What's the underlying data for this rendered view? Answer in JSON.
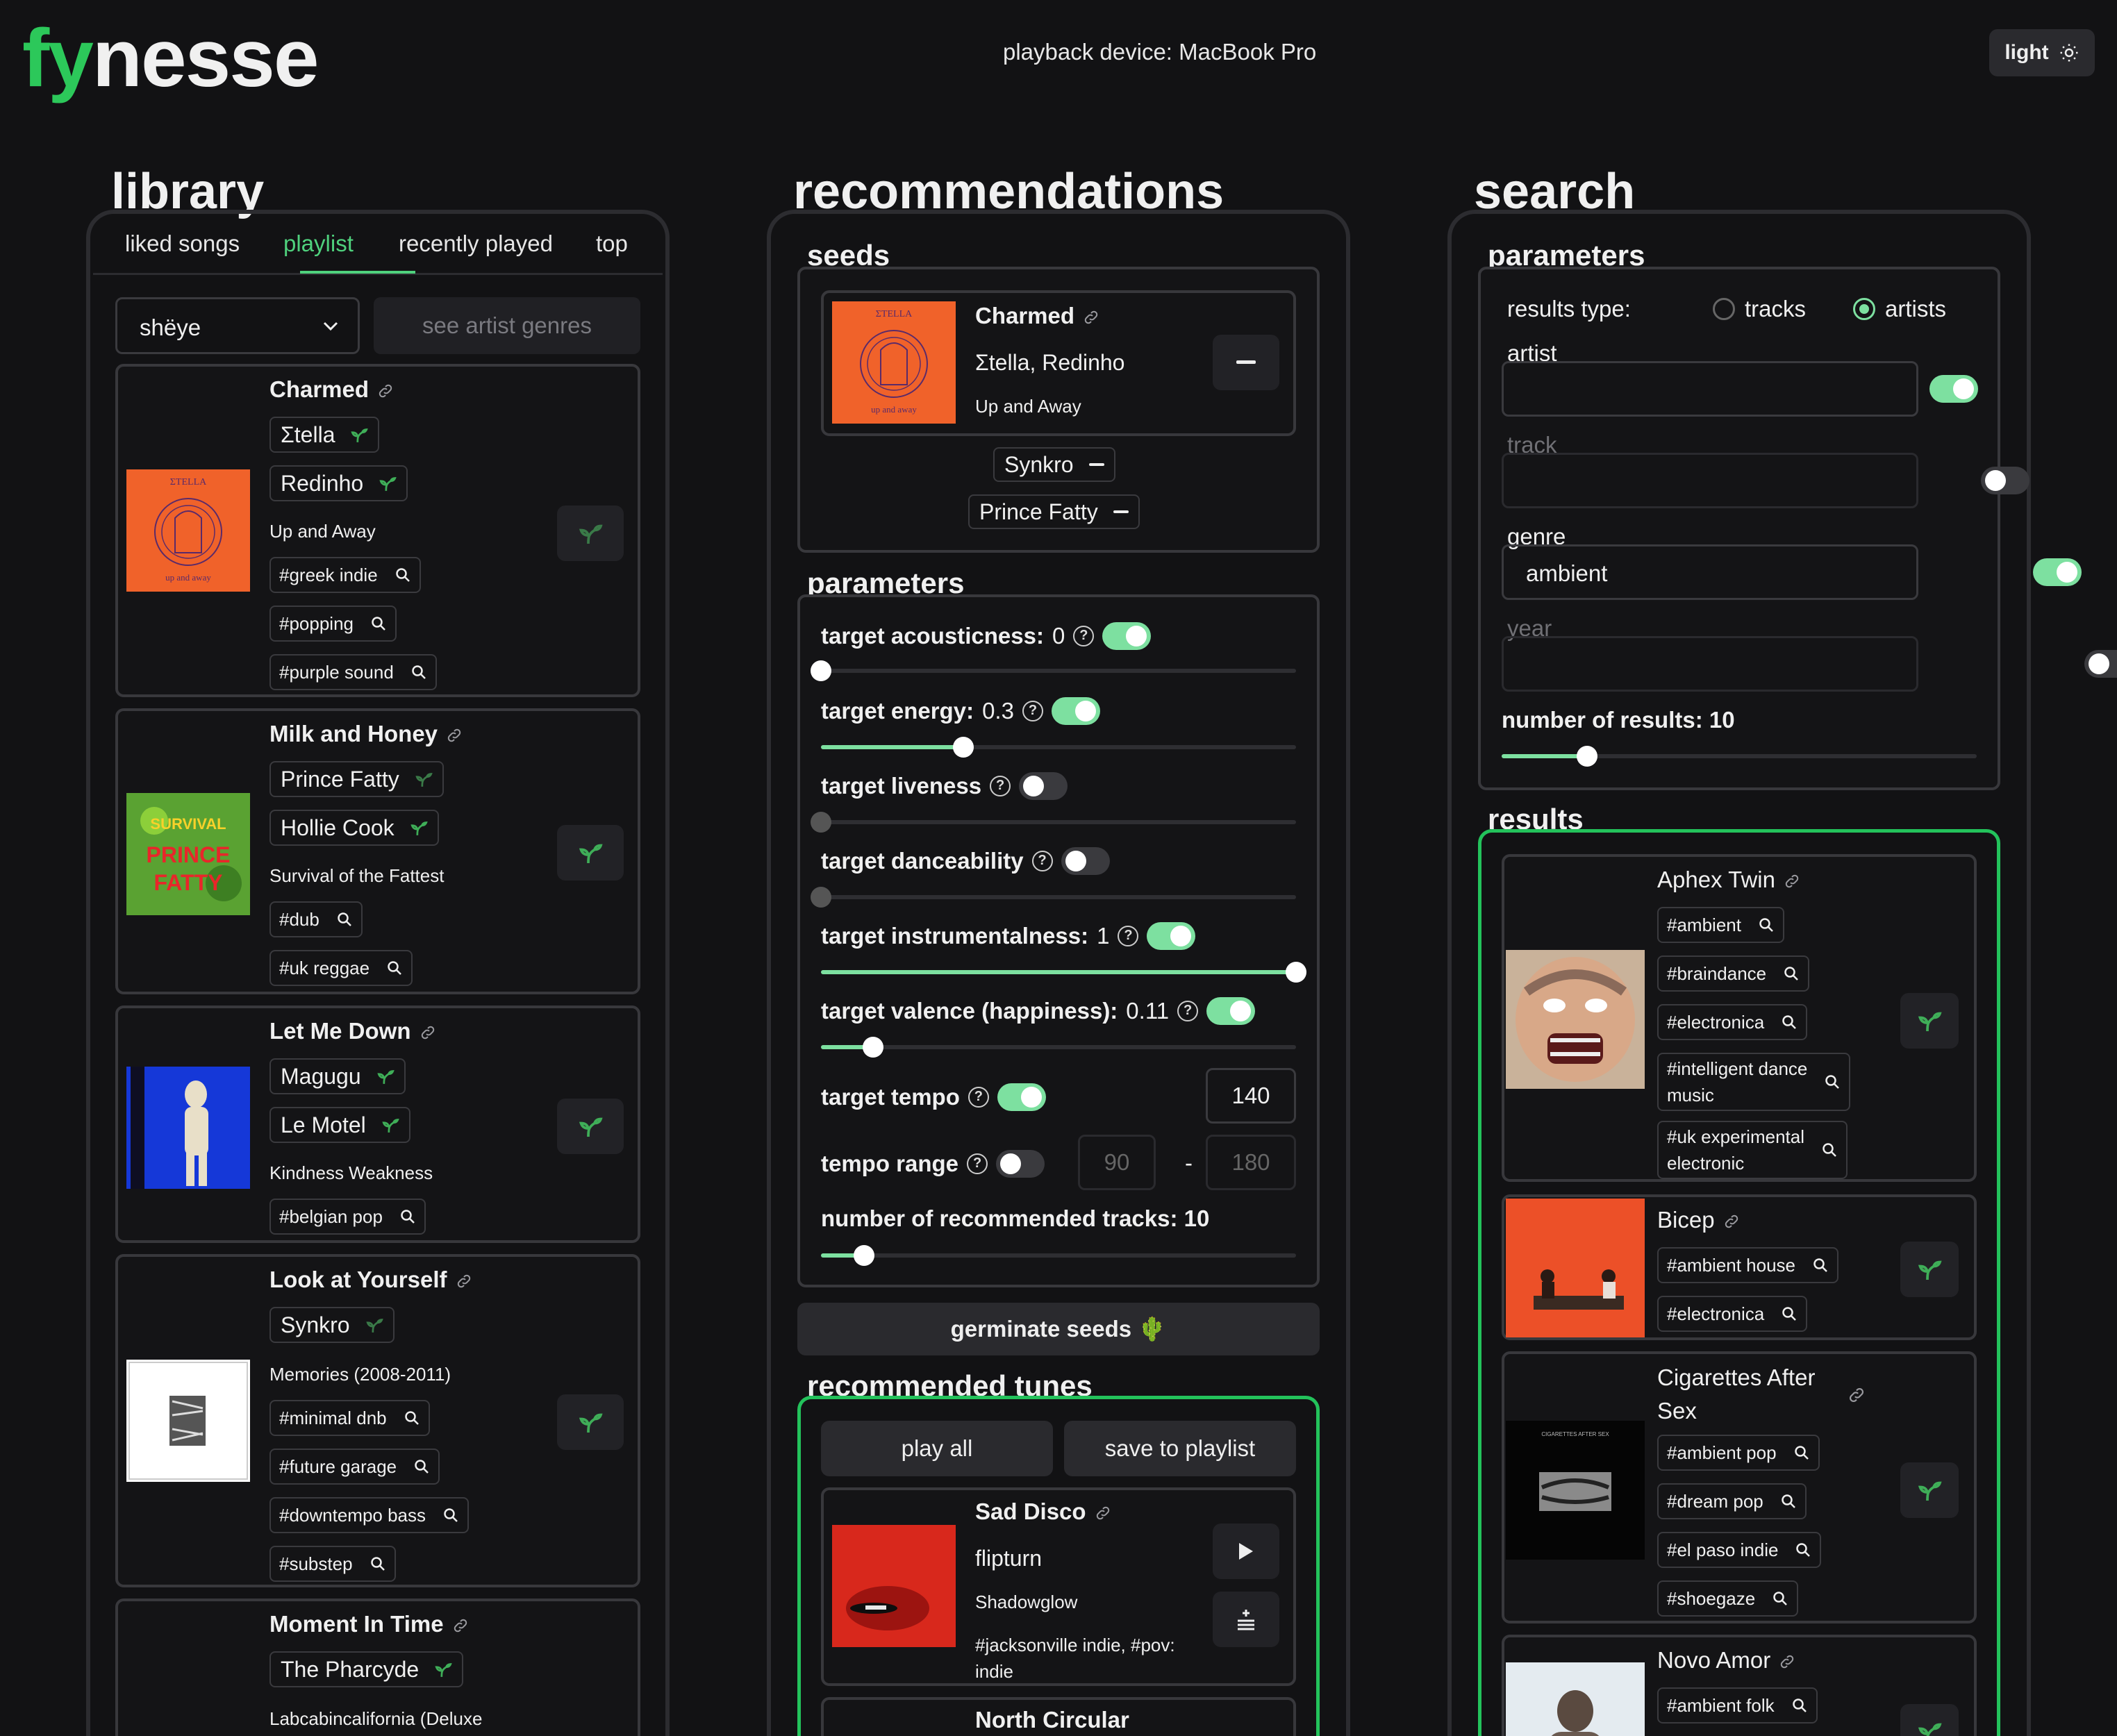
{
  "app": {
    "logo_part1": "fy",
    "logo_part2": "nesse",
    "device": "playback device: MacBook Pro",
    "theme_label": "light"
  },
  "library": {
    "title": "library",
    "tabs": [
      "liked songs",
      "playlist",
      "recently played",
      "top"
    ],
    "active_tab": "playlist",
    "playlist_select": "shëye",
    "see_genres": "see artist genres",
    "items": [
      {
        "title": "Charmed",
        "artists": [
          "Σtella",
          "Redinho"
        ],
        "album": "Up and Away",
        "tags": [
          "#greek indie",
          "#popping",
          "#purple sound"
        ]
      },
      {
        "title": "Milk and Honey",
        "artists": [
          "Prince Fatty",
          "Hollie Cook"
        ],
        "album": "Survival of the Fattest",
        "tags": [
          "#dub",
          "#uk reggae"
        ]
      },
      {
        "title": "Let Me Down",
        "artists": [
          "Magugu",
          "Le Motel"
        ],
        "album": "Kindness Weakness",
        "tags": [
          "#belgian pop"
        ]
      },
      {
        "title": "Look at Yourself",
        "artists": [
          "Synkro"
        ],
        "album": "Memories (2008-2011)",
        "tags": [
          "#minimal dnb",
          "#future garage",
          "#downtempo bass",
          "#substep"
        ]
      },
      {
        "title": "Moment In Time",
        "artists": [
          "The Pharcyde"
        ],
        "album": "Labcabincalifornia (Deluxe"
      }
    ]
  },
  "recommendations": {
    "title": "recommendations",
    "seeds_title": "seeds",
    "seed_track": {
      "title": "Charmed",
      "artists": "Σtella, Redinho",
      "album": "Up and Away"
    },
    "seed_artists": [
      "Synkro",
      "Prince Fatty"
    ],
    "params_title": "parameters",
    "params": {
      "acousticness": {
        "label": "target acousticness:",
        "value": "0",
        "enabled": true,
        "level": 0
      },
      "energy": {
        "label": "target energy:",
        "value": "0.3",
        "enabled": true,
        "level": 0.3
      },
      "liveness": {
        "label": "target liveness",
        "enabled": false,
        "level": 0
      },
      "danceability": {
        "label": "target danceability",
        "enabled": false,
        "level": 0
      },
      "instrumentalness": {
        "label": "target instrumentalness:",
        "value": "1",
        "enabled": true,
        "level": 1
      },
      "valence": {
        "label": "target valence (happiness):",
        "value": "0.11",
        "enabled": true,
        "level": 0.11
      },
      "tempo": {
        "label": "target tempo",
        "enabled": true,
        "value": "140"
      },
      "tempo_range": {
        "label": "tempo range",
        "enabled": false,
        "min": "90",
        "dash": "-",
        "max": "180"
      },
      "count": {
        "label": "number of recommended tracks: 10",
        "level": 0.09
      }
    },
    "germinate": "germinate seeds 🌵",
    "tunes_title": "recommended tunes",
    "play_all": "play all",
    "save_playlist": "save to playlist",
    "tunes": [
      {
        "title": "Sad Disco",
        "artist": "flipturn",
        "album": "Shadowglow",
        "tags_line1": "#jacksonville indie, #pov:",
        "tags_line2": "indie"
      },
      {
        "title": "North Circular"
      }
    ]
  },
  "search": {
    "title": "search",
    "params_title": "parameters",
    "results_type_label": "results type:",
    "type_tracks": "tracks",
    "type_artists": "artists",
    "selected_type": "artists",
    "fields": {
      "artist": {
        "label": "artist",
        "value": "",
        "enabled": true
      },
      "track": {
        "label": "track",
        "value": "",
        "enabled": false
      },
      "genre": {
        "label": "genre",
        "value": "ambient",
        "enabled": true
      },
      "year": {
        "label": "year",
        "value": "",
        "enabled": false
      }
    },
    "count_label": "number of results: 10",
    "count_level": 0.18,
    "results_title": "results",
    "results": [
      {
        "name": "Aphex Twin",
        "tags": [
          "#ambient",
          "#braindance",
          "#electronica"
        ],
        "tag_wrap1": [
          "#intelligent dance",
          "music"
        ],
        "tag_wrap2": [
          "#uk experimental",
          "electronic"
        ]
      },
      {
        "name": "Bicep",
        "tags": [
          "#ambient house",
          "#electronica"
        ]
      },
      {
        "name_line1": "Cigarettes After",
        "name_line2": "Sex",
        "tags": [
          "#ambient pop",
          "#dream pop",
          "#el paso indie",
          "#shoegaze"
        ],
        "cover_text": "CIGARETTES AFTER SEX"
      },
      {
        "name": "Novo Amor",
        "tags": [
          "#ambient folk"
        ]
      }
    ]
  },
  "colors": {
    "accent": "#2cc85a",
    "toggle_on": "#7de0a0",
    "background": "#121214"
  }
}
